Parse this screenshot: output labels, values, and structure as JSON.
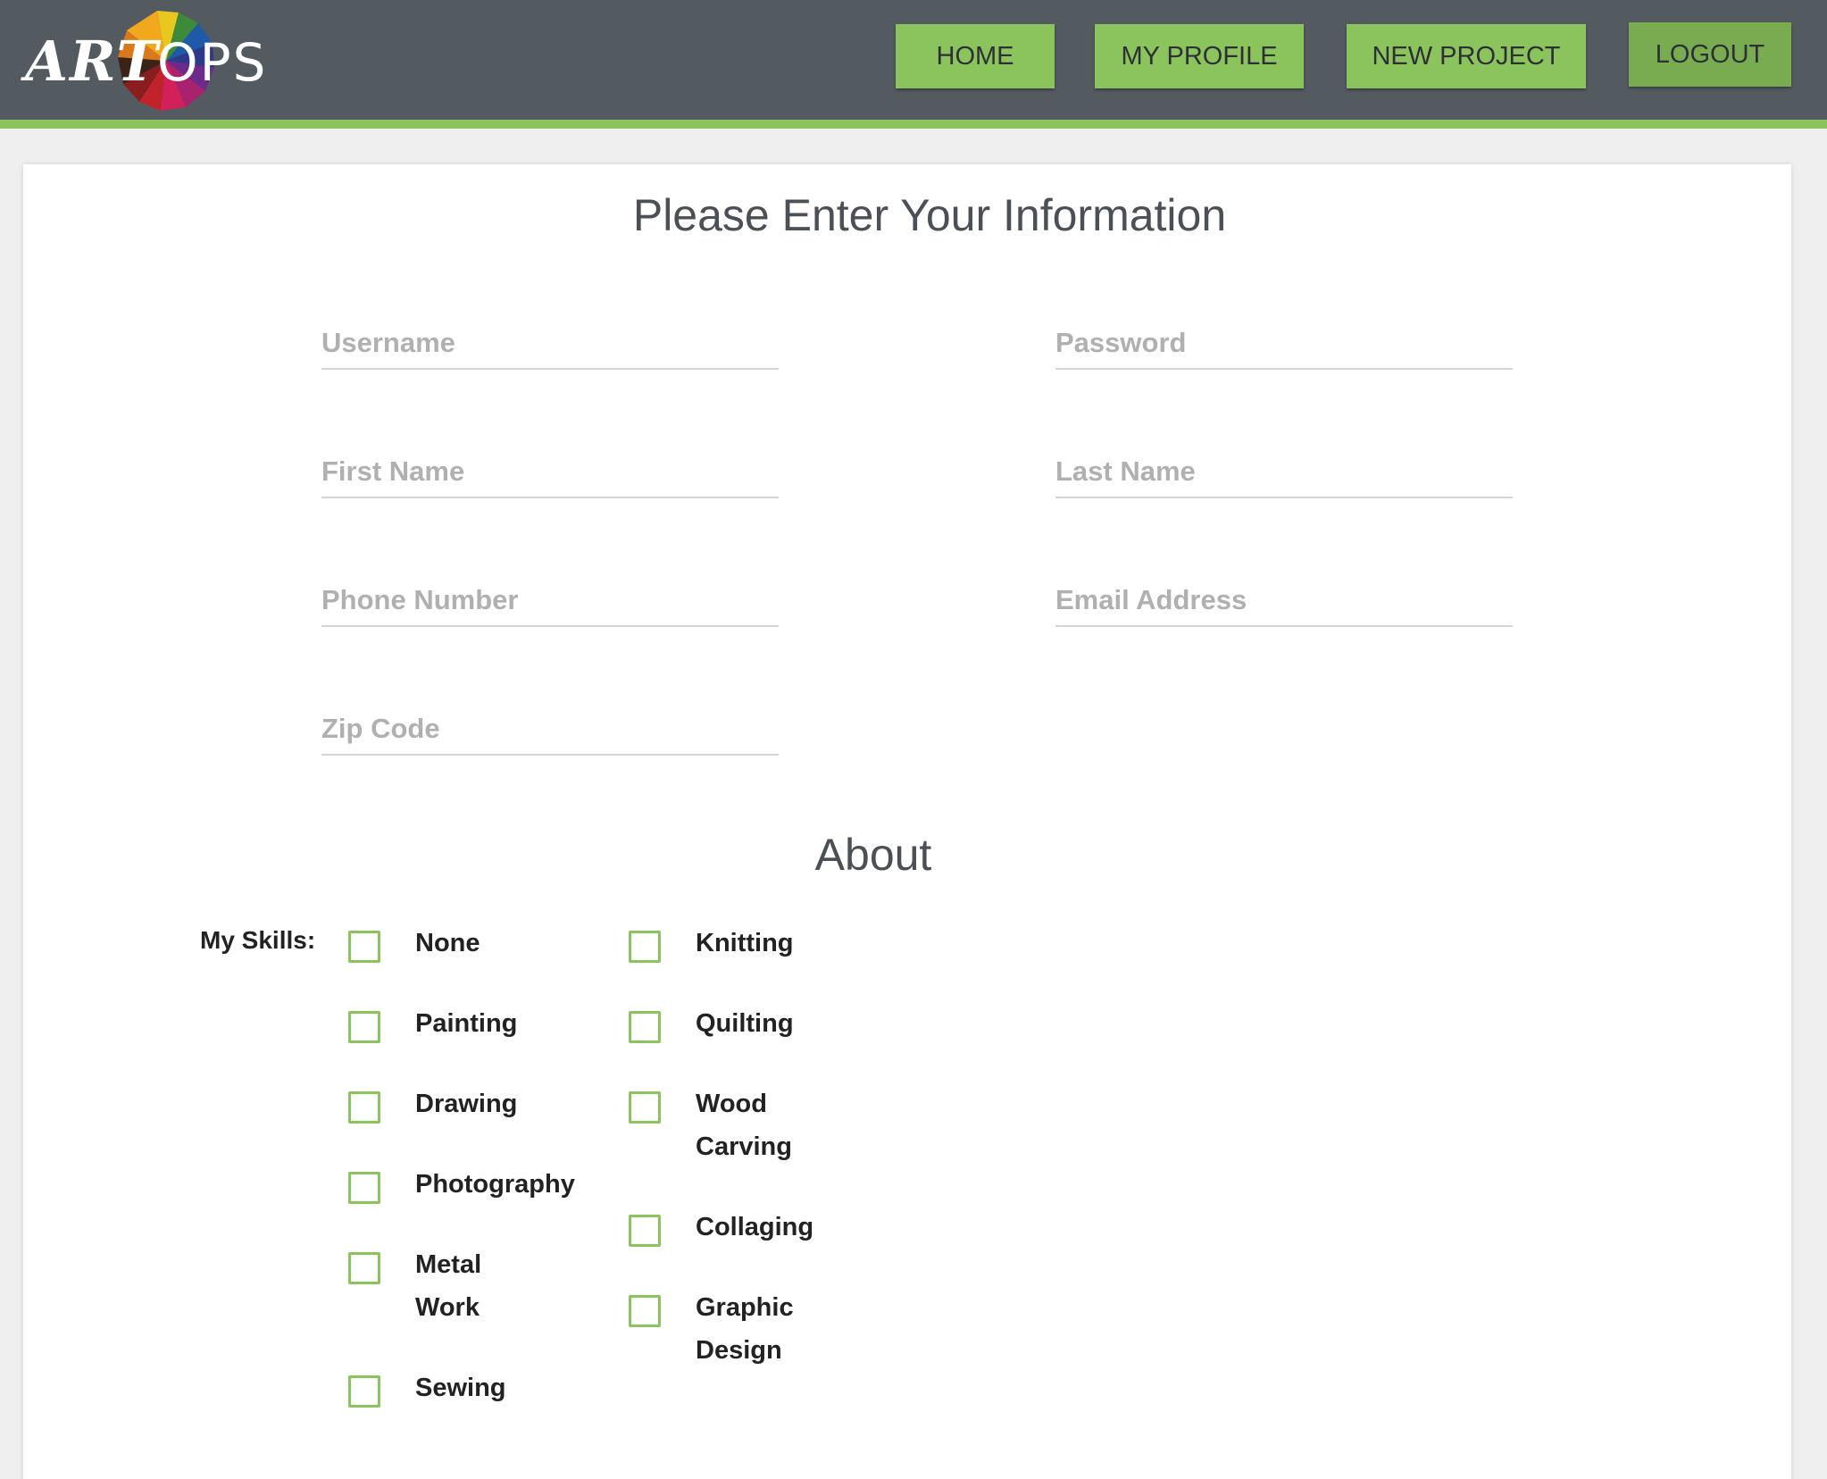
{
  "brand": {
    "logo_text_left": "ART",
    "logo_text_right": "OPS",
    "colors": {
      "header": "#545b60",
      "accent": "#8bc35c"
    }
  },
  "nav": {
    "home": "HOME",
    "my_profile": "MY PROFILE",
    "new_project": "NEW PROJECT",
    "logout": "LOGOUT"
  },
  "form": {
    "title": "Please Enter Your Information",
    "username_placeholder": "Username",
    "password_placeholder": "Password",
    "first_name_placeholder": "First Name",
    "last_name_placeholder": "Last Name",
    "phone_placeholder": "Phone Number",
    "email_placeholder": "Email Address",
    "zip_placeholder": "Zip Code"
  },
  "about": {
    "title": "About",
    "skills_label": "My Skills:",
    "skills_left": [
      "None",
      "Painting",
      "Drawing",
      "Photography",
      "Metal Work",
      "Sewing"
    ],
    "skills_right": [
      "Knitting",
      "Quilting",
      "Wood Carving",
      "Collaging",
      "Graphic Design"
    ]
  }
}
